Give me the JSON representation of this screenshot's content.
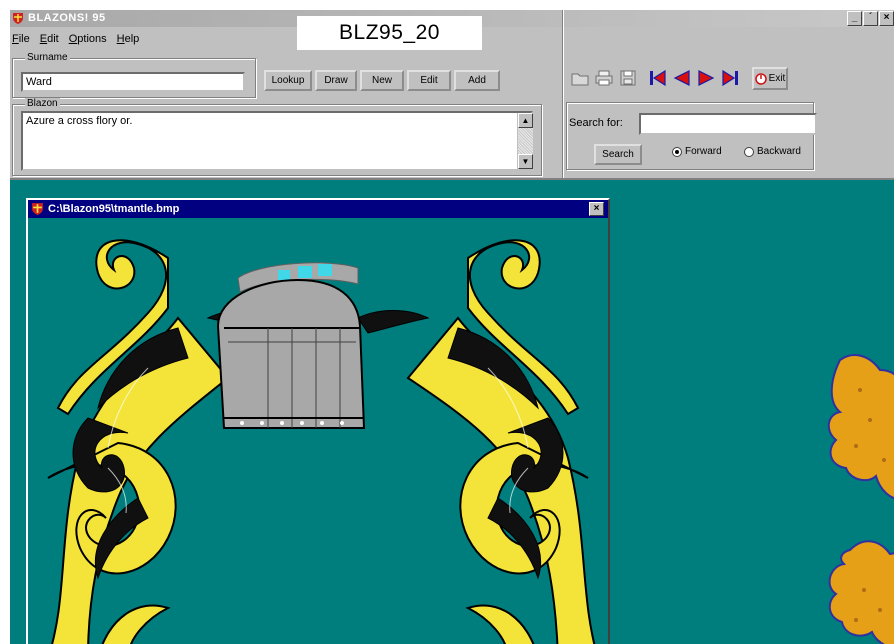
{
  "app": {
    "title": "BLAZONS! 95",
    "caption": "BLZ95_20",
    "window_buttons": [
      "_",
      "´",
      "×"
    ]
  },
  "menu": [
    "File",
    "Edit",
    "Options",
    "Help"
  ],
  "surname": {
    "label": "Surname",
    "value": "Ward"
  },
  "blazon": {
    "label": "Blazon",
    "value": "Azure a cross flory or."
  },
  "actions": {
    "lookup": "Lookup",
    "draw": "Draw",
    "new": "New",
    "edit": "Edit",
    "add": "Add"
  },
  "toolbar": {
    "icons": [
      "open-icon",
      "print-icon",
      "save-icon",
      "first-record-icon",
      "prev-record-icon",
      "next-record-icon",
      "last-record-icon",
      "exit-icon"
    ],
    "exit_label": "Exit"
  },
  "search": {
    "label": "Search for:",
    "value": "",
    "button": "Search",
    "forward": "Forward",
    "backward": "Backward",
    "direction": "forward"
  },
  "child_window": {
    "title": "C:\\Blazon95\\tmantle.bmp",
    "close": "×"
  },
  "colors": {
    "face": "#c0c0c0",
    "workspace": "#007d7d",
    "child_title": "#000080",
    "mantling_gold": "#f4e43a",
    "mantling_black": "#101010",
    "helm_grey": "#a8a8a8",
    "lion_gold": "#e6a018"
  }
}
